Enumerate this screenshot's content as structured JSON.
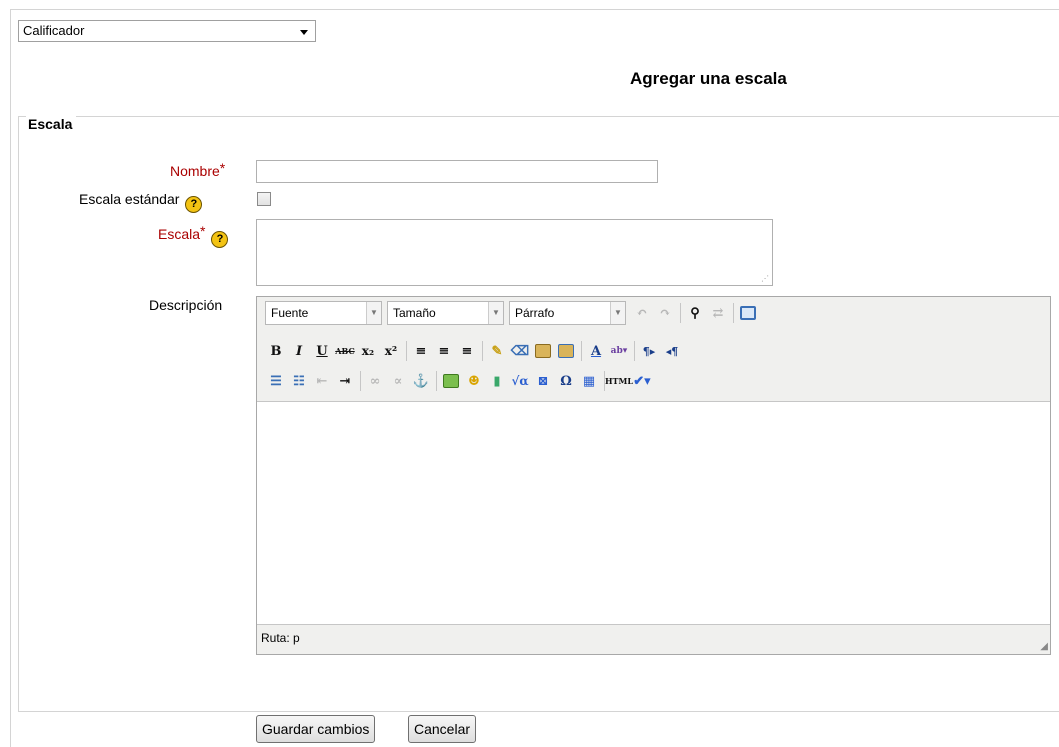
{
  "grader_select": {
    "value": "Calificador"
  },
  "page_title": "Agregar una escala",
  "fieldset": {
    "legend": "Escala"
  },
  "fields": {
    "name_label": "Nombre",
    "standard_label": "Escala estándar",
    "scale_label": "Escala",
    "description_label": "Descripción",
    "required_mark": "*",
    "help_glyph": "?"
  },
  "editor": {
    "font_combo": "Fuente",
    "size_combo": "Tamaño",
    "format_combo": "Párrafo",
    "path_label": "Ruta: p"
  },
  "buttons": {
    "save": "Guardar cambios",
    "cancel": "Cancelar"
  },
  "colors": {
    "required": "#aa0000",
    "help_icon": "#f3c313"
  }
}
